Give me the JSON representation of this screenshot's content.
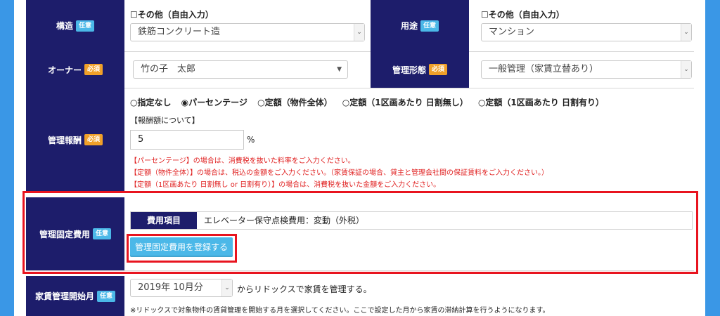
{
  "structure": {
    "label": "構造",
    "badge": "任意",
    "other_label": "☐その他（自由入力）",
    "value": "鉄筋コンクリート造"
  },
  "usage": {
    "label": "用途",
    "badge": "任意",
    "other_label": "☐その他（自由入力）",
    "value": "マンション"
  },
  "owner": {
    "label": "オーナー",
    "badge": "必須",
    "value": "竹の子　太郎"
  },
  "management_type": {
    "label": "管理形態",
    "badge": "必須",
    "value": "一般管理（家賃立替あり）"
  },
  "fee": {
    "label": "管理報酬",
    "badge": "必須",
    "options": [
      "○指定なし",
      "◉パーセンテージ",
      "○定額（物件全体）",
      "○定額（1区画あたり 日割無し）",
      "○定額（1区画あたり 日割有り）"
    ],
    "about": "【報酬額について】",
    "value": "5",
    "unit": "%",
    "notes": [
      "【パーセンテージ】の場合は、消費税を抜いた料率をご入力ください。",
      "【定額（物件全体）】の場合は、税込の金額をご入力ください。（家賃保証の場合、貸主と管理会社間の保証賃料をご入力ください。）",
      "【定額（1区画あたり 日割無し or 日割有り）】の場合は、消費税を抜いた金額をご入力ください。"
    ]
  },
  "fixed_cost": {
    "label": "管理固定費用",
    "badge": "任意",
    "item_header": "費用項目",
    "item_value": "エレベーター保守点検費用：変動（外税）",
    "register_button": "管理固定費用を登録する"
  },
  "rent_start": {
    "label": "家賃管理開始月",
    "badge": "任意",
    "value": "2019年 10月分",
    "suffix": "からリドックスで家賃を管理する。",
    "note": "※リドックスで対象物件の賃貸管理を開始する月を選択してください。ここで設定した月から家賃の滞納計算を行うようになります。"
  },
  "colors": {
    "label_bg": "#1d1d6b",
    "highlight": "#e8141f",
    "button": "#4bb8e8",
    "page_bg": "#3a97e6"
  }
}
